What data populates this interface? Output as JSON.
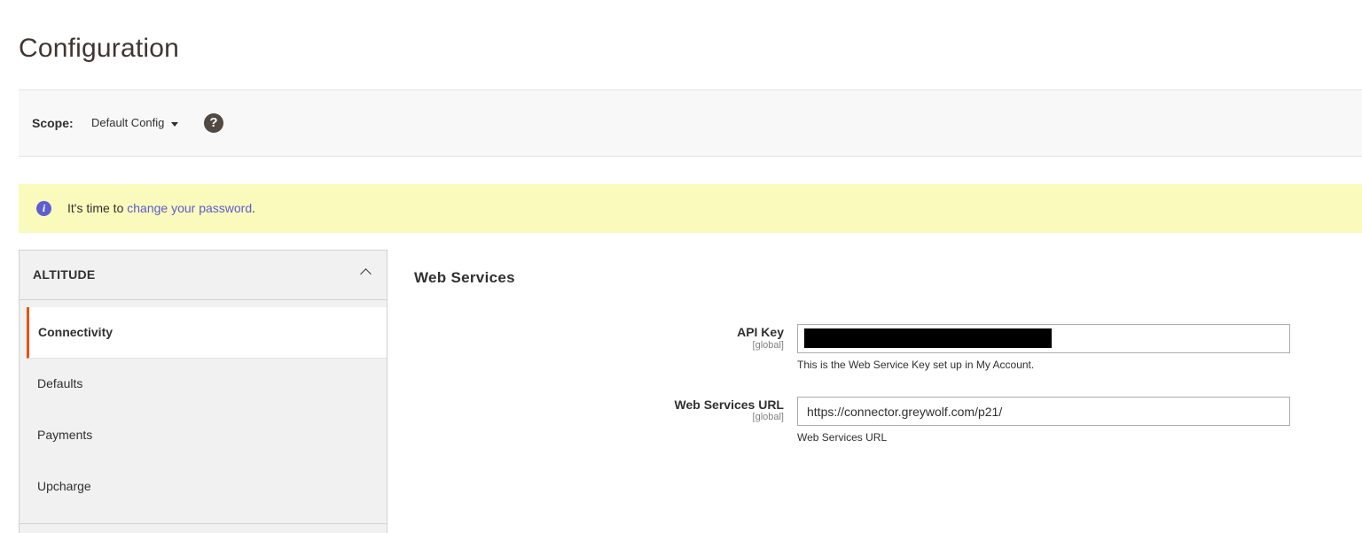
{
  "page": {
    "title": "Configuration"
  },
  "scope": {
    "label": "Scope:",
    "selected": "Default Config",
    "help_glyph": "?"
  },
  "notice": {
    "prefix": "It's time to ",
    "link": "change your password",
    "suffix": ".",
    "icon_glyph": "i"
  },
  "sidebar": {
    "title": "ALTITUDE",
    "items": [
      {
        "label": "Connectivity",
        "active": true
      },
      {
        "label": "Defaults",
        "active": false
      },
      {
        "label": "Payments",
        "active": false
      },
      {
        "label": "Upcharge",
        "active": false
      }
    ]
  },
  "section": {
    "title": "Web Services",
    "fields": [
      {
        "label": "API Key",
        "scope": "[global]",
        "value": "",
        "note": "This is the Web Service Key set up in My Account."
      },
      {
        "label": "Web Services URL",
        "scope": "[global]",
        "value": "https://connector.greywolf.com/p21/",
        "note": "Web Services URL"
      }
    ]
  },
  "colors": {
    "accent": "#eb5202",
    "notice_bg": "#fafabc",
    "link": "#5b5bcf"
  }
}
